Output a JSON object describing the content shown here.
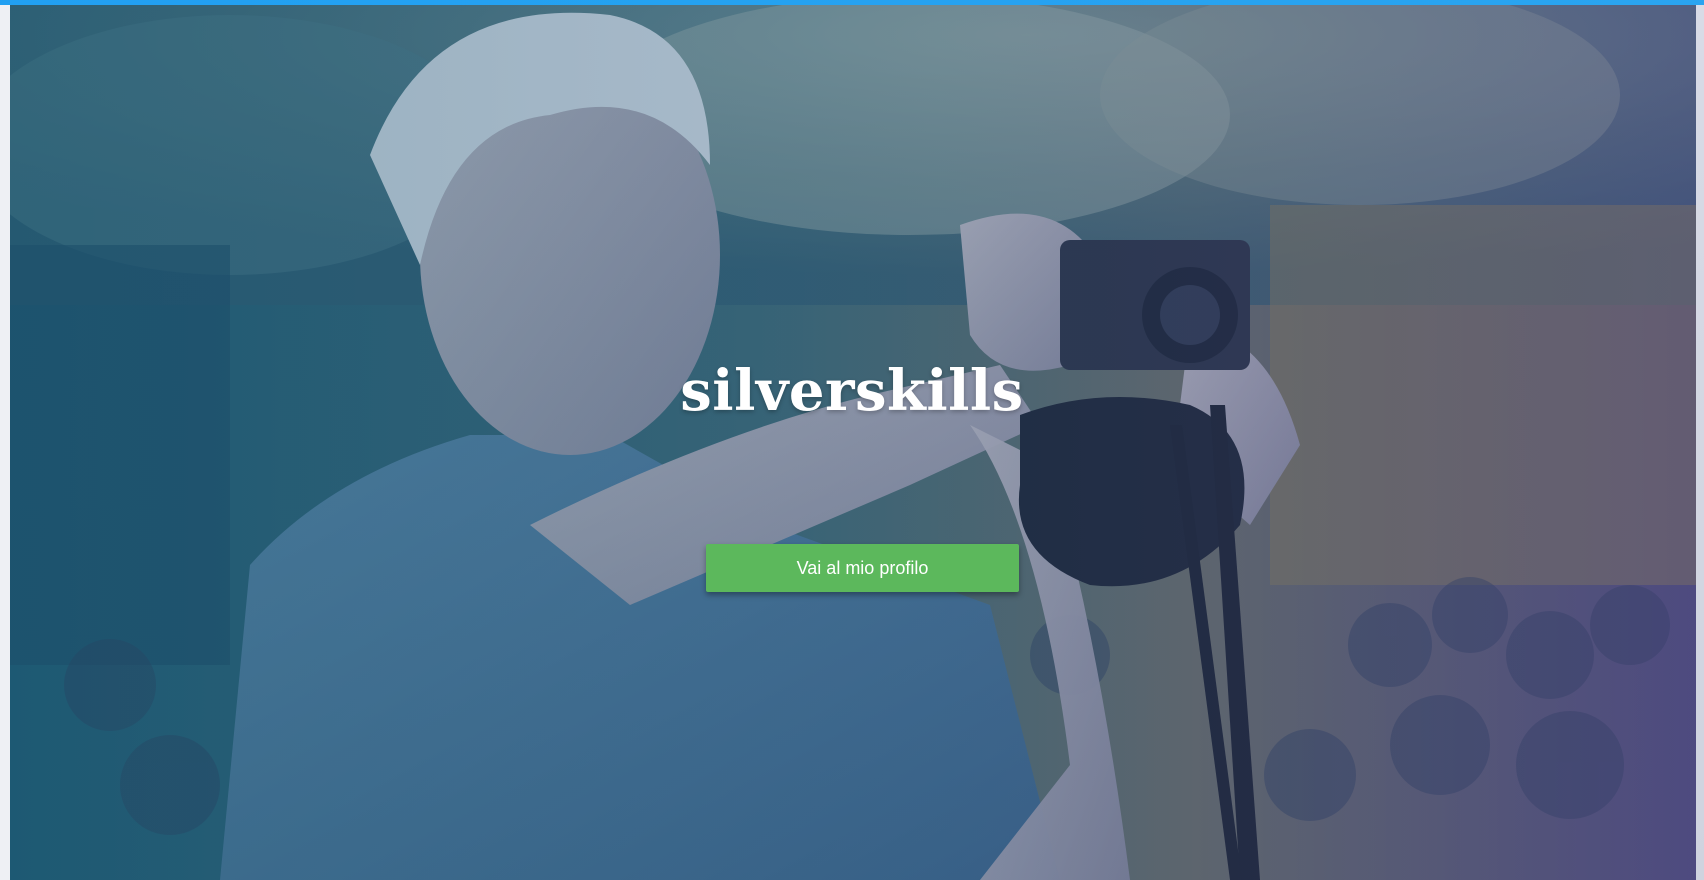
{
  "hero": {
    "title": "silverskills",
    "cta_label": "Vai al mio profilo",
    "image_description_icon": "photo-background",
    "accent_color": "#5cb85c",
    "overlay_color": "#2a5f86",
    "top_bar_color": "#21a0f2"
  }
}
